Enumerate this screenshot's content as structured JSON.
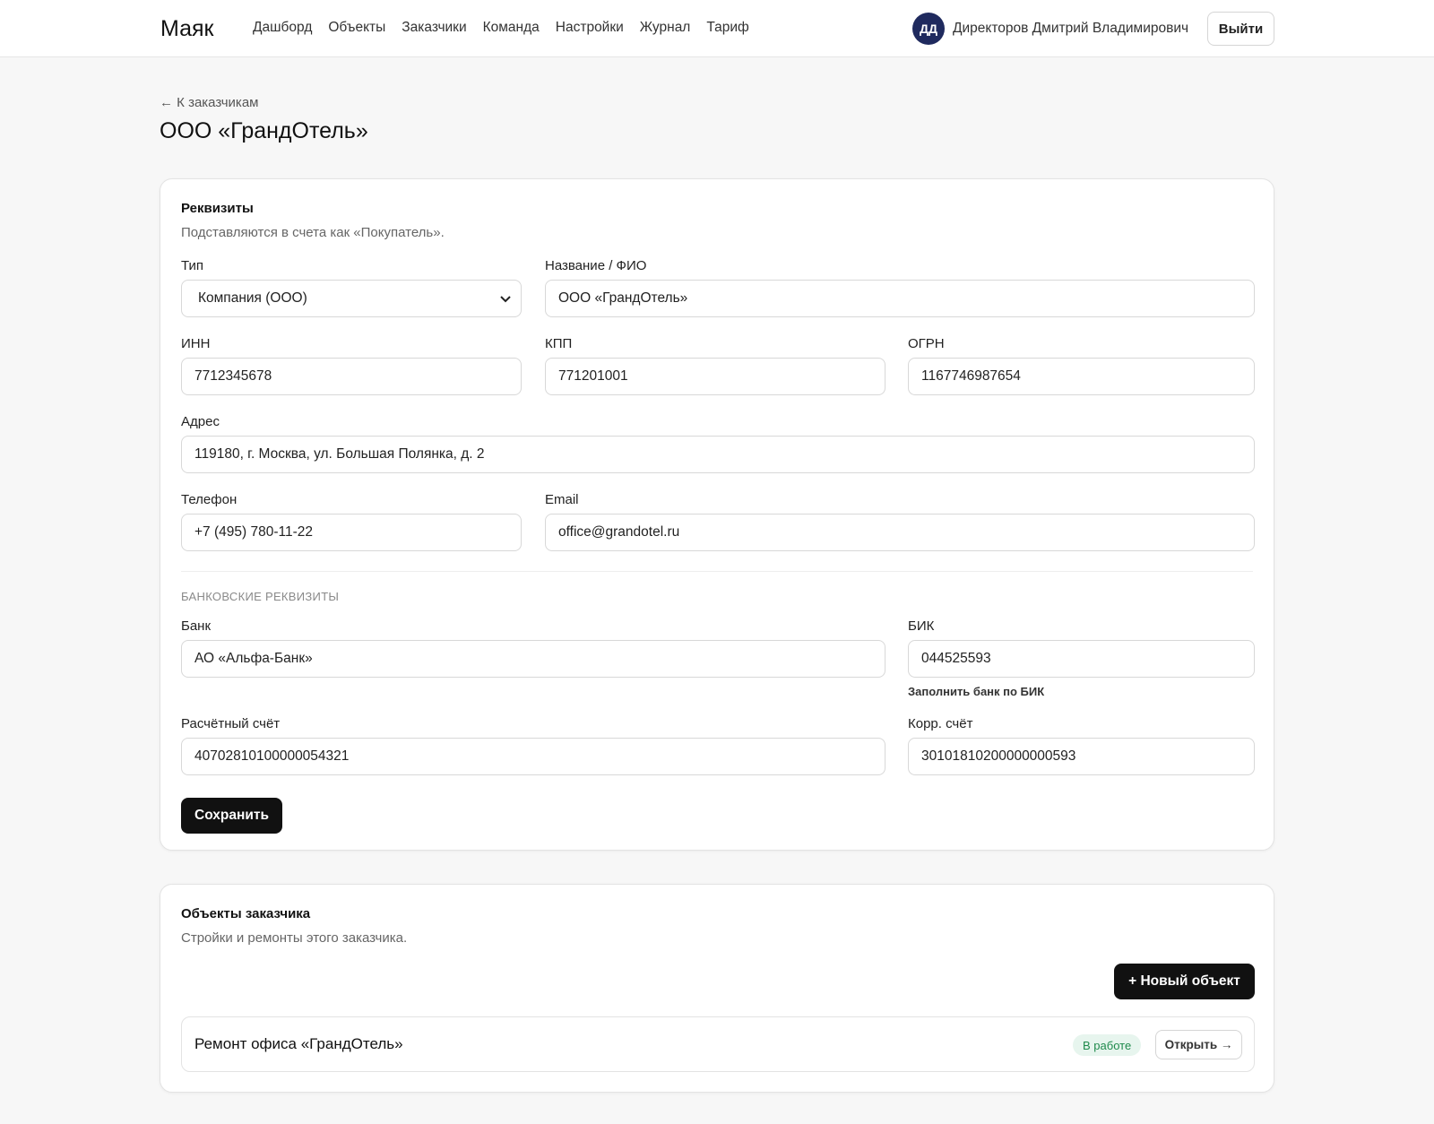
{
  "header": {
    "brand": "Маяк",
    "nav": [
      "Дашборд",
      "Объекты",
      "Заказчики",
      "Команда",
      "Настройки",
      "Журнал",
      "Тариф"
    ],
    "avatar_initials": "ДД",
    "user_name": "Директоров Дмитрий Владимирович",
    "logout_label": "Выйти"
  },
  "page": {
    "back_label": "← К заказчикам",
    "title": "ООО «ГрандОтель»"
  },
  "requisites": {
    "title": "Реквизиты",
    "subtitle": "Подставляются в счета как «Покупатель».",
    "type": {
      "label": "Тип",
      "value": "Компания (ООО)"
    },
    "name": {
      "label": "Название / ФИО",
      "value": "ООО «ГрандОтель»"
    },
    "inn": {
      "label": "ИНН",
      "value": "7712345678"
    },
    "kpp": {
      "label": "КПП",
      "value": "771201001"
    },
    "ogrn": {
      "label": "ОГРН",
      "value": "1167746987654"
    },
    "address": {
      "label": "Адрес",
      "value": "119180, г. Москва, ул. Большая Полянка, д. 2"
    },
    "phone": {
      "label": "Телефон",
      "value": "+7 (495) 780-11-22"
    },
    "email": {
      "label": "Email",
      "value": "office@grandotel.ru"
    },
    "bank_section": "БАНКОВСКИЕ РЕКВИЗИТЫ",
    "bank": {
      "label": "Банк",
      "value": "АО «Альфа-Банк»"
    },
    "bik": {
      "label": "БИК",
      "value": "044525593",
      "helper": "Заполнить банк по БИК"
    },
    "account": {
      "label": "Расчётный счёт",
      "value": "40702810100000054321"
    },
    "corr_account": {
      "label": "Корр. счёт",
      "value": "30101810200000000593"
    },
    "save_label": "Сохранить"
  },
  "objects": {
    "title": "Объекты заказчика",
    "subtitle": "Стройки и ремонты этого заказчика.",
    "new_label": "+ Новый объект",
    "items": [
      {
        "name": "Ремонт офиса «ГрандОтель»",
        "status": "В работе",
        "open_label": "Открыть →"
      }
    ]
  },
  "colors": {
    "accent_dark": "#111111",
    "avatar_bg": "#1f2a5e",
    "status_bg": "#e7f5ee",
    "status_text": "#1f8a4c"
  }
}
